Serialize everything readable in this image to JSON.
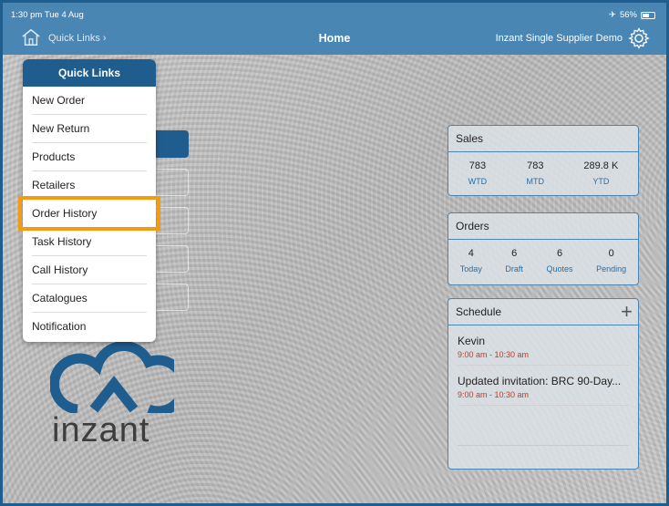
{
  "status": {
    "time_date": "1:30 pm   Tue 4 Aug",
    "battery": "56%"
  },
  "header": {
    "quick_links_label": "Quick Links ›",
    "title": "Home",
    "supplier": "Inzant Single Supplier Demo"
  },
  "quick_links": {
    "title": "Quick Links",
    "items": [
      "New Order",
      "New Return",
      "Products",
      "Retailers",
      "Order History",
      "Task History",
      "Call History",
      "Catalogues",
      "Notification"
    ],
    "highlighted": "Order History",
    "highlight_color": "#f39c12"
  },
  "logo": {
    "text": "inzant"
  },
  "sales": {
    "title": "Sales",
    "stats": [
      {
        "value": "783",
        "label": "WTD"
      },
      {
        "value": "783",
        "label": "MTD"
      },
      {
        "value": "289.8 K",
        "label": "YTD"
      }
    ]
  },
  "orders": {
    "title": "Orders",
    "stats": [
      {
        "value": "4",
        "label": "Today"
      },
      {
        "value": "6",
        "label": "Draft"
      },
      {
        "value": "6",
        "label": "Quotes"
      },
      {
        "value": "0",
        "label": "Pending"
      }
    ]
  },
  "schedule": {
    "title": "Schedule",
    "add_label": "+",
    "events": [
      {
        "title": "Kevin",
        "time": "9:00 am - 10:30 am"
      },
      {
        "title": "Updated invitation: BRC 90-Day...",
        "time": "9:00 am - 10:30 am"
      }
    ]
  },
  "colors": {
    "brand_dark": "#1f5d8e",
    "brand_bar": "#4a86b4",
    "stat_label": "#1f6fb0",
    "event_time": "#c0392b"
  }
}
